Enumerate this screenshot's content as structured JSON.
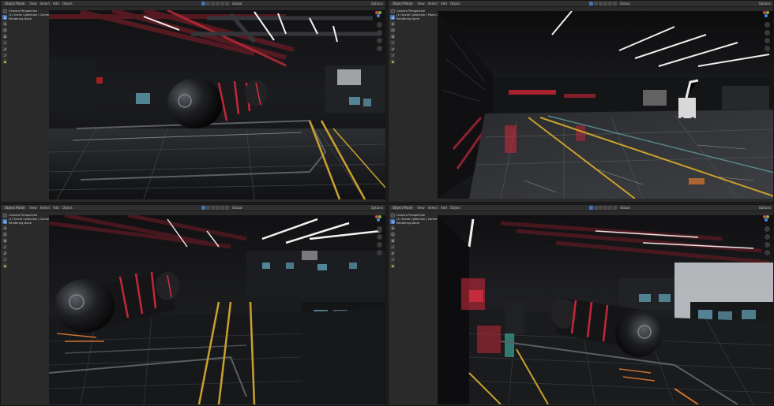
{
  "viewports": [
    {
      "id": "top-left",
      "header": {
        "mode": "Object Mode",
        "view": "View",
        "select": "Select",
        "add": "Add",
        "object": "Object",
        "transform": "Global",
        "options": "Options"
      },
      "overlay": {
        "line1": "Camera Perspective",
        "line2": "(1) Scene Collection | Camera",
        "line3": "Rendering Done"
      }
    },
    {
      "id": "top-right",
      "header": {
        "mode": "Object Mode",
        "view": "View",
        "select": "Select",
        "add": "Add",
        "object": "Object",
        "transform": "Global",
        "options": "Options"
      },
      "overlay": {
        "line1": "Camera Perspective",
        "line2": "(1) Scene Collection | Plane.010",
        "line3": "Rendering Done"
      }
    },
    {
      "id": "bottom-left",
      "header": {
        "mode": "Object Mode",
        "view": "View",
        "select": "Select",
        "add": "Add",
        "object": "Object",
        "transform": "Global",
        "options": "Options"
      },
      "overlay": {
        "line1": "Camera Perspective",
        "line2": "(1) Scene Collection | Camera",
        "line3": "Rendering Done"
      }
    },
    {
      "id": "bottom-right",
      "header": {
        "mode": "Object Mode",
        "view": "View",
        "select": "Select",
        "add": "Add",
        "object": "Object",
        "transform": "Global",
        "options": "Options"
      },
      "overlay": {
        "line1": "Camera Perspective",
        "line2": "(1) Scene Collection | Camera.001",
        "line3": "Rendering Done"
      }
    }
  ],
  "colors": {
    "accent": "#4772b3",
    "panel": "#2a2a2a",
    "header": "#303030",
    "gizmo_x": "#e0464b",
    "gizmo_y": "#7eb63f",
    "gizmo_z": "#4b87e0"
  },
  "icons": [
    "select-box-icon",
    "cursor-icon",
    "move-icon",
    "rotate-icon",
    "scale-icon",
    "transform-icon",
    "annotate-icon",
    "measure-icon",
    "add-cube-icon"
  ]
}
